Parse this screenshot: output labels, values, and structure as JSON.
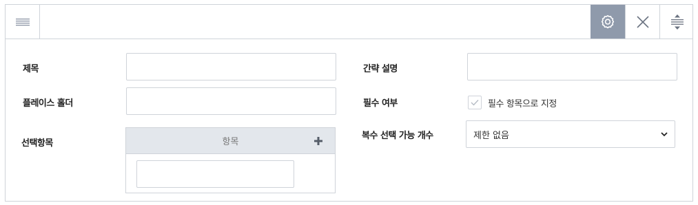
{
  "toolbar": {
    "menu_icon": "list-lines-icon",
    "settings_icon": "gear-icon",
    "close_icon": "close-icon",
    "expand_icon": "expand-vertical-icon",
    "accent_color": "#8f9aab"
  },
  "form": {
    "title_label": "제목",
    "title_value": "",
    "placeholder_label": "플레이스 홀더",
    "placeholder_value": "",
    "options_label": "선택항목",
    "options_header": "항목",
    "options_add_icon": "plus-icon",
    "option_value": "",
    "description_label": "간략 설명",
    "description_value": "",
    "required_label": "필수 여부",
    "required_checkbox_label": "필수 항목으로 지정",
    "required_checked": false,
    "multi_select_label": "복수 선택 가능 개수",
    "multi_select_value": "제한 없음"
  }
}
